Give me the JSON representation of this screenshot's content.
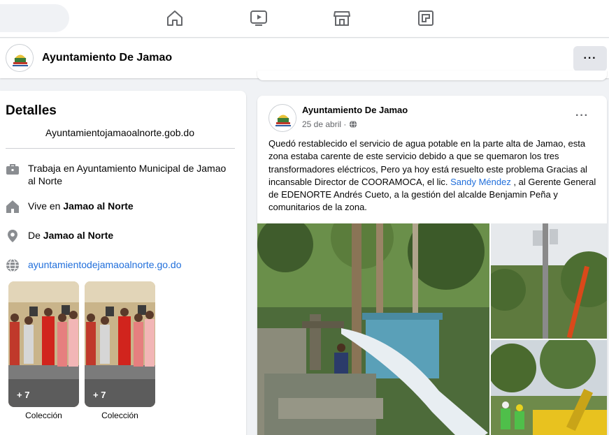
{
  "nav": {
    "icons": [
      "home-icon",
      "watch-icon",
      "marketplace-icon",
      "gaming-icon"
    ]
  },
  "page": {
    "name": "Ayuntamiento De Jamao",
    "more_label": "···"
  },
  "details": {
    "title": "Detalles",
    "website_top": "Ayuntamientojamaoalnorte.gob.do",
    "work_prefix": "Trabaja en ",
    "work_place": "Ayuntamiento Municipal de Jamao al Norte",
    "lives_prefix": "Vive en ",
    "lives_place": "Jamao al Norte",
    "from_prefix": "De ",
    "from_place": "Jamao al Norte",
    "website_link": "ayuntamientodejamaoalnorte.go.do",
    "collections": [
      {
        "count": "+ 7",
        "label": "Colección"
      },
      {
        "count": "+ 7",
        "label": "Colección"
      }
    ]
  },
  "post": {
    "author": "Ayuntamiento De Jamao",
    "date": "25 de abril",
    "date_sep": " · ",
    "more": "···",
    "text_before": "Quedó restablecido el servicio de agua potable en la parte alta de Jamao, esta zona estaba  carente de este  servicio debido a que se quemaron los tres transformadores eléctricos, Pero ya hoy está resuelto este problema Gracias al incansable Director de COORAMOCA, el lic. ",
    "mention": "Sandy Méndez",
    "text_after": " , al Gerente General de EDENORTE Andrés Cueto, a la gestión del alcalde Benjamin Peña y comunitarios de la zona."
  },
  "colors": {
    "link": "#216fdb",
    "bg": "#f0f2f5",
    "secondary_text": "#65676b"
  }
}
